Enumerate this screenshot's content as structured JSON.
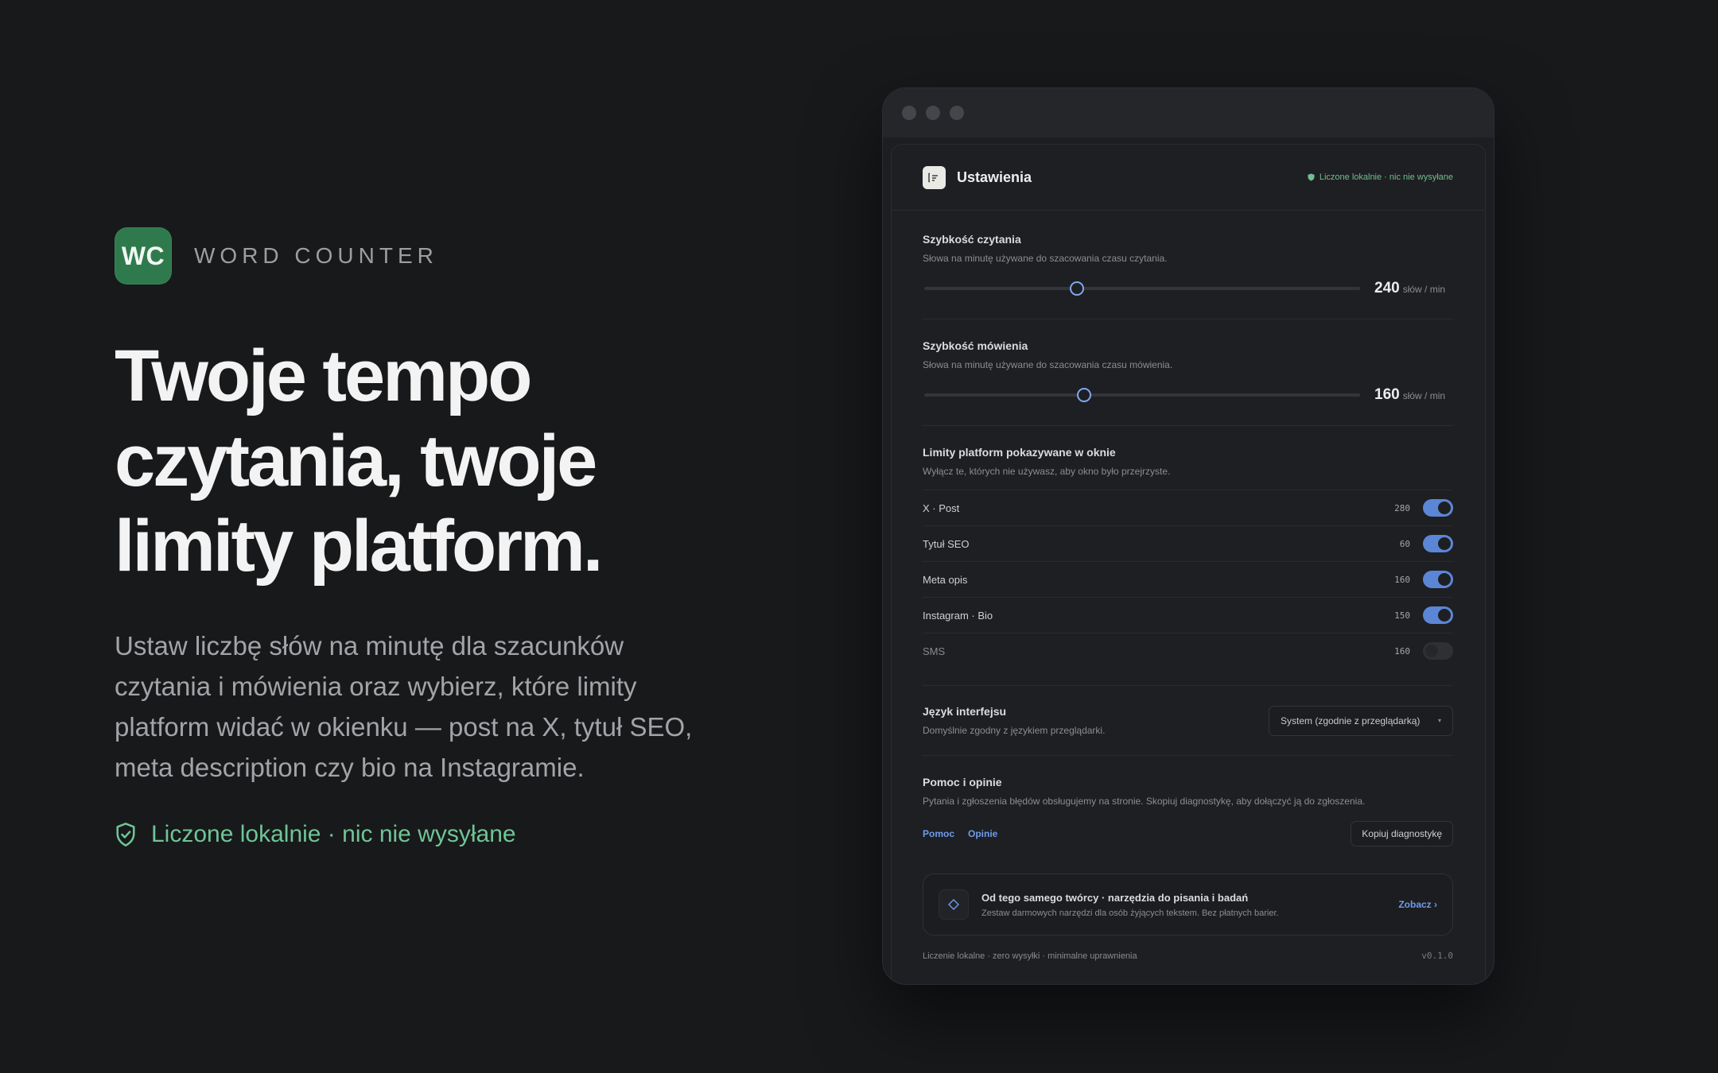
{
  "hero": {
    "logo_text": "WC",
    "brand": "WORD COUNTER",
    "headline": "Twoje tempo czytania, twoje limity platform.",
    "lead": "Ustaw liczbę słów na minutę dla szacunków czytania i mówienia oraz wybierz, które limity platform widać w okienku — post na X, tytuł SEO, meta description czy bio na Instagramie.",
    "local_note": "Liczone lokalnie · nic nie wysyłane",
    "accent_color": "#6fc596",
    "logo_color": "#2f7a4d"
  },
  "window": {
    "header": {
      "title": "Ustawienia",
      "privacy_badge": "Liczone lokalnie · nic nie wysyłane"
    },
    "reading_speed": {
      "title": "Szybkość czytania",
      "subtitle": "Słowa na minutę używane do szacowania czasu czytania.",
      "value": "240",
      "unit": "słów / min",
      "position_fraction": 0.35
    },
    "speaking_speed": {
      "title": "Szybkość mówienia",
      "subtitle": "Słowa na minutę używane do szacowania czasu mówienia.",
      "value": "160",
      "unit": "słów / min",
      "position_fraction": 0.367
    },
    "platform_limits": {
      "title": "Limity platform pokazywane w oknie",
      "subtitle": "Wyłącz te, których nie używasz, aby okno było przejrzyste.",
      "items": [
        {
          "label": "X · Post",
          "limit": "280",
          "enabled": true
        },
        {
          "label": "Tytuł SEO",
          "limit": "60",
          "enabled": true
        },
        {
          "label": "Meta opis",
          "limit": "160",
          "enabled": true
        },
        {
          "label": "Instagram · Bio",
          "limit": "150",
          "enabled": true
        },
        {
          "label": "SMS",
          "limit": "160",
          "enabled": false
        }
      ]
    },
    "language": {
      "title": "Język interfejsu",
      "subtitle": "Domyślnie zgodny z językiem przeglądarki.",
      "selected": "System (zgodnie z przeglądarką)"
    },
    "help": {
      "title": "Pomoc i opinie",
      "subtitle": "Pytania i zgłoszenia błędów obsługujemy na stronie. Skopiuj diagnostykę, aby dołączyć ją do zgłoszenia.",
      "help_link": "Pomoc",
      "feedback_link": "Opinie",
      "copy_button": "Kopiuj diagnostykę"
    },
    "promo": {
      "title": "Od tego samego twórcy · narzędzia do pisania i badań",
      "subtitle": "Zestaw darmowych narzędzi dla osób żyjących tekstem. Bez płatnych barier.",
      "link": "Zobacz ›",
      "icon": "diamond-icon"
    },
    "footer": {
      "note": "Liczenie lokalne · zero wysyłki · minimalne uprawnienia",
      "version": "v0.1.0"
    }
  }
}
